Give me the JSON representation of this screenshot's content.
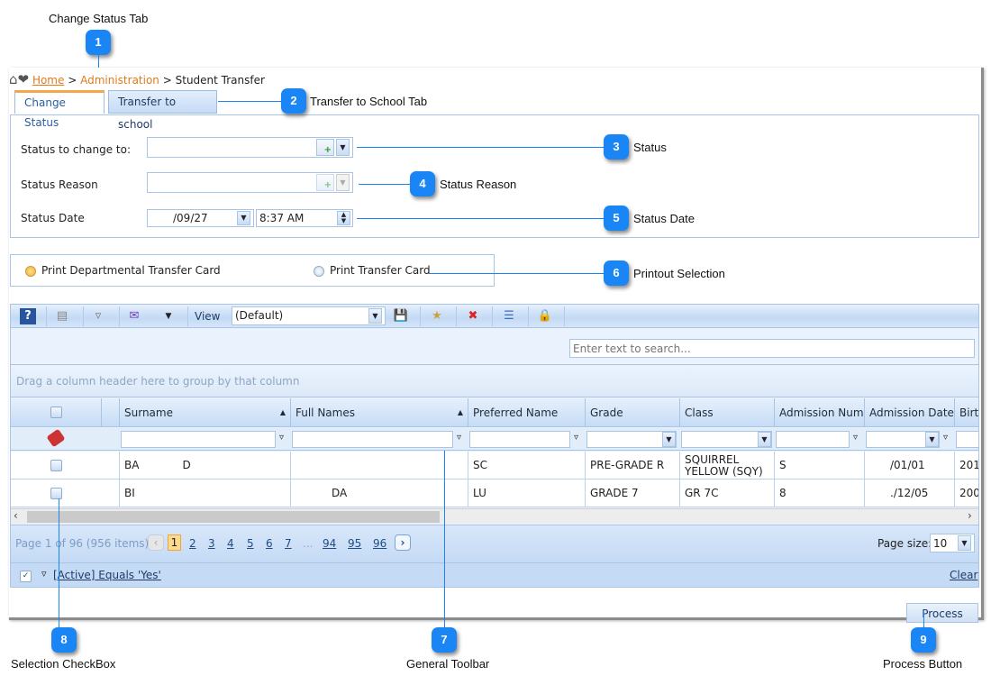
{
  "callouts": [
    {
      "num": "1",
      "label": "Change Status Tab"
    },
    {
      "num": "2",
      "label": "Transfer to School Tab"
    },
    {
      "num": "3",
      "label": "Status"
    },
    {
      "num": "4",
      "label": "Status Reason"
    },
    {
      "num": "5",
      "label": "Status Date"
    },
    {
      "num": "6",
      "label": "Printout Selection"
    },
    {
      "num": "7",
      "label": "General Toolbar"
    },
    {
      "num": "8",
      "label": "Selection CheckBox"
    },
    {
      "num": "9",
      "label": "Process Button"
    }
  ],
  "breadcrumb": {
    "home": "Home",
    "sep1": ">",
    "admin": "Administration",
    "sep2": ">",
    "current": "Student Transfer"
  },
  "tabs": [
    {
      "label": "Change Status",
      "active": true
    },
    {
      "label": "Transfer to school",
      "active": false
    }
  ],
  "form": {
    "status_label": "Status to change to:",
    "status_value": "",
    "reason_label": "Status Reason",
    "reason_value": "",
    "date_label": "Status Date",
    "date_value": "/09/27",
    "time_value": "8:37 AM"
  },
  "printout": {
    "option1": "Print Departmental Transfer Card",
    "option2": "Print Transfer Card",
    "selected": "option1"
  },
  "toolbar": {
    "view_label": "View",
    "view_value": "(Default)",
    "icons": [
      "help-icon",
      "group-panel-icon",
      "filter-icon",
      "export-icon",
      "dropdown-arrow-icon",
      "save-layout-icon",
      "new-layout-icon",
      "delete-layout-icon",
      "column-chooser-icon",
      "lock-icon"
    ]
  },
  "search": {
    "placeholder": "Enter text to search..."
  },
  "group_hint": "Drag a column header here to group by that column",
  "columns": [
    "Surname",
    "Full Names",
    "Preferred Name",
    "Grade",
    "Class",
    "Admission Numbe",
    "Admission Date",
    "Birth"
  ],
  "rows": [
    {
      "surname": "BA",
      "surname2": "D",
      "fullnames": "",
      "preferred": "SC",
      "grade": "PRE-GRADE R",
      "class1": "SQUIRREL",
      "class2": "YELLOW (SQY)",
      "admno": "S",
      "admdate": "​/01/01",
      "birth": "201"
    },
    {
      "surname": "BI",
      "surname2": "",
      "fullnames": "DA",
      "preferred": "LU",
      "grade": "GRADE 7",
      "class1": "GR 7C",
      "class2": "",
      "admno": "8",
      "admdate": "./12/05",
      "birth": "200"
    }
  ],
  "pager": {
    "summary": "Page 1 of 96 (956 items)",
    "pages": [
      "1",
      "2",
      "3",
      "4",
      "5",
      "6",
      "7",
      "...",
      "94",
      "95",
      "96"
    ],
    "current": "1",
    "page_size_label": "Page size:",
    "page_size": "10"
  },
  "filter": {
    "expression": "[Active] Equals 'Yes'",
    "clear": "Clear",
    "enabled": true
  },
  "process_label": "Process",
  "colors": {
    "accent": "#1a86f5",
    "link_orange": "#e07b1a",
    "grid_blue": "#c4daf5"
  }
}
